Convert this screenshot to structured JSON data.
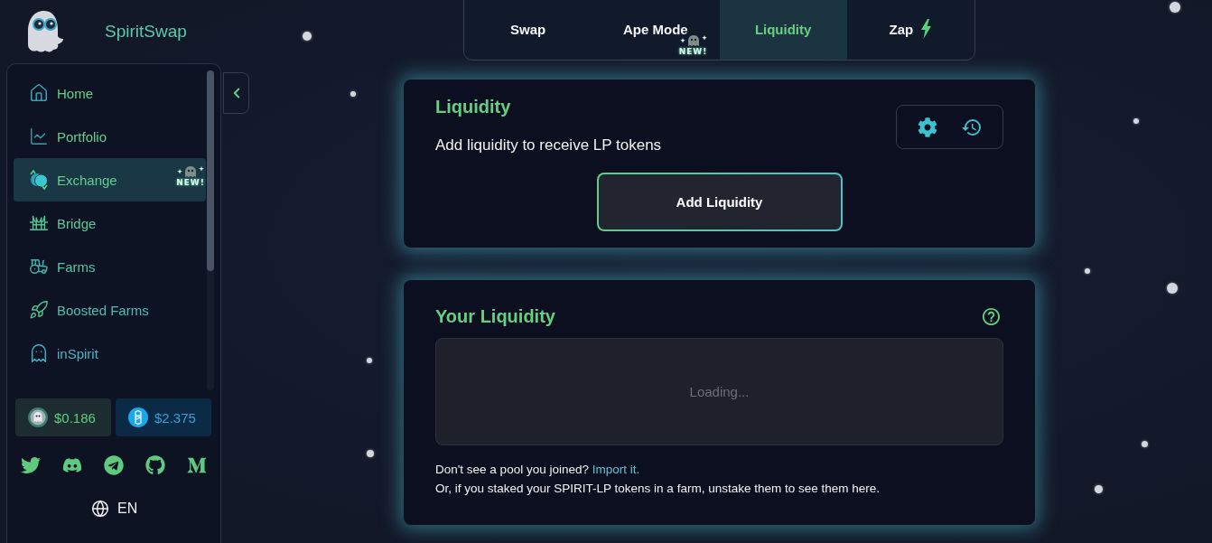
{
  "brand": {
    "name": "SpiritSwap"
  },
  "sidebar": {
    "items": [
      {
        "kind": "home",
        "label": "Home",
        "selected": false
      },
      {
        "kind": "portfolio",
        "label": "Portfolio",
        "selected": false
      },
      {
        "kind": "exchange",
        "label": "Exchange",
        "selected": true,
        "badge": "NEW!"
      },
      {
        "kind": "bridge",
        "label": "Bridge",
        "selected": false
      },
      {
        "kind": "farms",
        "label": "Farms",
        "selected": false
      },
      {
        "kind": "boosted",
        "label": "Boosted Farms",
        "selected": false
      },
      {
        "kind": "inspirit",
        "label": "inSpirit",
        "selected": false
      }
    ],
    "prices": [
      {
        "kind": "spirit",
        "value": "$0.186"
      },
      {
        "kind": "ftm",
        "value": "$2.375"
      }
    ],
    "socials": [
      {
        "kind": "twitter"
      },
      {
        "kind": "discord"
      },
      {
        "kind": "telegram"
      },
      {
        "kind": "github"
      },
      {
        "kind": "medium"
      }
    ],
    "language": "EN"
  },
  "tabs": [
    {
      "kind": "plain",
      "label": "Swap",
      "selected": false
    },
    {
      "kind": "plain",
      "label": "Ape Mode",
      "selected": false,
      "badge": "NEW!"
    },
    {
      "kind": "plain",
      "label": "Liquidity",
      "selected": true
    },
    {
      "kind": "bolt",
      "label": "Zap",
      "selected": false
    }
  ],
  "add_card": {
    "title": "Liquidity",
    "subtitle": "Add liquidity to receive LP tokens",
    "button": "Add Liquidity"
  },
  "positions_card": {
    "title": "Your Liquidity",
    "loading": "Loading...",
    "hint": "Don't see a pool you joined?",
    "link": "Import it.",
    "note": "Or, if you staked your SPIRIT-LP tokens in a farm, unstake them to see them here."
  }
}
